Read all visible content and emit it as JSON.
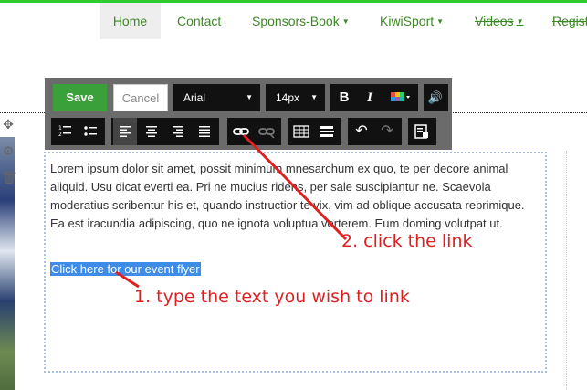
{
  "nav": {
    "items": [
      {
        "label": "Home",
        "dropdown": false
      },
      {
        "label": "Contact",
        "dropdown": false
      },
      {
        "label": "Sponsors-Book",
        "dropdown": true
      },
      {
        "label": "KiwiSport",
        "dropdown": true
      },
      {
        "label": "Videos",
        "dropdown": true
      },
      {
        "label": "Regist",
        "dropdown": false
      }
    ]
  },
  "toolbar": {
    "save_label": "Save",
    "cancel_label": "Cancel",
    "font_value": "Arial",
    "size_value": "14px",
    "bold_label": "B",
    "italic_label": "I"
  },
  "editor": {
    "body_text": "Lorem ipsum dolor sit amet, possit minimum mnesarchum ex quo, te per decore animal aliquid. Usu dicat everti ea. Pri ne mucius ridens, per sale suscipiantur ne. Scaevola moderatius scribentur his et, quando instructior te vix, vim ad oblique accusata reprimique. Ea est iracundia adipiscing, quo ne ignota voluptua verterem. Eum doming volutpat ut.",
    "selected_link_text": "Click here for our event flyer"
  },
  "annotations": {
    "step1": "1. type the text you wish to link",
    "step2": "2. click the link"
  },
  "colors": {
    "accent_green": "#3aa03a",
    "nav_text": "#3a8a22",
    "annotation_red": "#e02020",
    "selection_blue": "#3e8be8"
  }
}
